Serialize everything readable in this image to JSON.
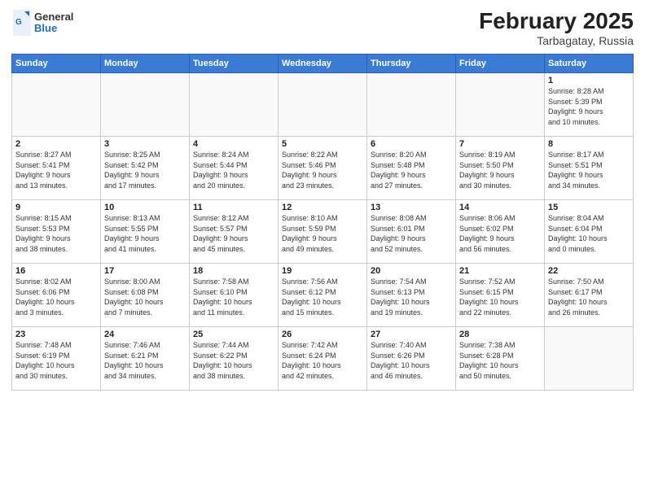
{
  "header": {
    "logo_general": "General",
    "logo_blue": "Blue",
    "title": "February 2025",
    "subtitle": "Tarbagatay, Russia"
  },
  "weekdays": [
    "Sunday",
    "Monday",
    "Tuesday",
    "Wednesday",
    "Thursday",
    "Friday",
    "Saturday"
  ],
  "weeks": [
    [
      {
        "day": "",
        "info": ""
      },
      {
        "day": "",
        "info": ""
      },
      {
        "day": "",
        "info": ""
      },
      {
        "day": "",
        "info": ""
      },
      {
        "day": "",
        "info": ""
      },
      {
        "day": "",
        "info": ""
      },
      {
        "day": "1",
        "info": "Sunrise: 8:28 AM\nSunset: 5:39 PM\nDaylight: 9 hours\nand 10 minutes."
      }
    ],
    [
      {
        "day": "2",
        "info": "Sunrise: 8:27 AM\nSunset: 5:41 PM\nDaylight: 9 hours\nand 13 minutes."
      },
      {
        "day": "3",
        "info": "Sunrise: 8:25 AM\nSunset: 5:42 PM\nDaylight: 9 hours\nand 17 minutes."
      },
      {
        "day": "4",
        "info": "Sunrise: 8:24 AM\nSunset: 5:44 PM\nDaylight: 9 hours\nand 20 minutes."
      },
      {
        "day": "5",
        "info": "Sunrise: 8:22 AM\nSunset: 5:46 PM\nDaylight: 9 hours\nand 23 minutes."
      },
      {
        "day": "6",
        "info": "Sunrise: 8:20 AM\nSunset: 5:48 PM\nDaylight: 9 hours\nand 27 minutes."
      },
      {
        "day": "7",
        "info": "Sunrise: 8:19 AM\nSunset: 5:50 PM\nDaylight: 9 hours\nand 30 minutes."
      },
      {
        "day": "8",
        "info": "Sunrise: 8:17 AM\nSunset: 5:51 PM\nDaylight: 9 hours\nand 34 minutes."
      }
    ],
    [
      {
        "day": "9",
        "info": "Sunrise: 8:15 AM\nSunset: 5:53 PM\nDaylight: 9 hours\nand 38 minutes."
      },
      {
        "day": "10",
        "info": "Sunrise: 8:13 AM\nSunset: 5:55 PM\nDaylight: 9 hours\nand 41 minutes."
      },
      {
        "day": "11",
        "info": "Sunrise: 8:12 AM\nSunset: 5:57 PM\nDaylight: 9 hours\nand 45 minutes."
      },
      {
        "day": "12",
        "info": "Sunrise: 8:10 AM\nSunset: 5:59 PM\nDaylight: 9 hours\nand 49 minutes."
      },
      {
        "day": "13",
        "info": "Sunrise: 8:08 AM\nSunset: 6:01 PM\nDaylight: 9 hours\nand 52 minutes."
      },
      {
        "day": "14",
        "info": "Sunrise: 8:06 AM\nSunset: 6:02 PM\nDaylight: 9 hours\nand 56 minutes."
      },
      {
        "day": "15",
        "info": "Sunrise: 8:04 AM\nSunset: 6:04 PM\nDaylight: 10 hours\nand 0 minutes."
      }
    ],
    [
      {
        "day": "16",
        "info": "Sunrise: 8:02 AM\nSunset: 6:06 PM\nDaylight: 10 hours\nand 3 minutes."
      },
      {
        "day": "17",
        "info": "Sunrise: 8:00 AM\nSunset: 6:08 PM\nDaylight: 10 hours\nand 7 minutes."
      },
      {
        "day": "18",
        "info": "Sunrise: 7:58 AM\nSunset: 6:10 PM\nDaylight: 10 hours\nand 11 minutes."
      },
      {
        "day": "19",
        "info": "Sunrise: 7:56 AM\nSunset: 6:12 PM\nDaylight: 10 hours\nand 15 minutes."
      },
      {
        "day": "20",
        "info": "Sunrise: 7:54 AM\nSunset: 6:13 PM\nDaylight: 10 hours\nand 19 minutes."
      },
      {
        "day": "21",
        "info": "Sunrise: 7:52 AM\nSunset: 6:15 PM\nDaylight: 10 hours\nand 22 minutes."
      },
      {
        "day": "22",
        "info": "Sunrise: 7:50 AM\nSunset: 6:17 PM\nDaylight: 10 hours\nand 26 minutes."
      }
    ],
    [
      {
        "day": "23",
        "info": "Sunrise: 7:48 AM\nSunset: 6:19 PM\nDaylight: 10 hours\nand 30 minutes."
      },
      {
        "day": "24",
        "info": "Sunrise: 7:46 AM\nSunset: 6:21 PM\nDaylight: 10 hours\nand 34 minutes."
      },
      {
        "day": "25",
        "info": "Sunrise: 7:44 AM\nSunset: 6:22 PM\nDaylight: 10 hours\nand 38 minutes."
      },
      {
        "day": "26",
        "info": "Sunrise: 7:42 AM\nSunset: 6:24 PM\nDaylight: 10 hours\nand 42 minutes."
      },
      {
        "day": "27",
        "info": "Sunrise: 7:40 AM\nSunset: 6:26 PM\nDaylight: 10 hours\nand 46 minutes."
      },
      {
        "day": "28",
        "info": "Sunrise: 7:38 AM\nSunset: 6:28 PM\nDaylight: 10 hours\nand 50 minutes."
      },
      {
        "day": "",
        "info": ""
      }
    ]
  ]
}
